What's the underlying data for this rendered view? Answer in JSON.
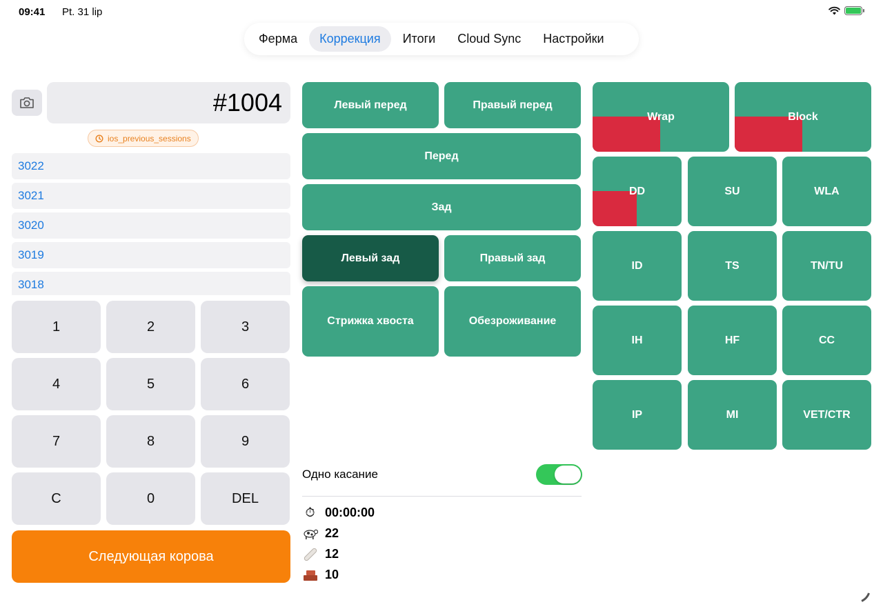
{
  "status": {
    "time": "09:41",
    "date": "Pt. 31 lip",
    "battery_color": "#34c759"
  },
  "tabs": [
    {
      "label": "Ферма",
      "active": false
    },
    {
      "label": "Коррекция",
      "active": true
    },
    {
      "label": "Итоги",
      "active": false
    },
    {
      "label": "Cloud Sync",
      "active": false
    },
    {
      "label": "Настройки",
      "active": false
    }
  ],
  "current_id": "#1004",
  "sessions_badge": "ios_previous_sessions",
  "history": [
    "3022",
    "3021",
    "3020",
    "3019",
    "3018"
  ],
  "keypad": [
    "1",
    "2",
    "3",
    "4",
    "5",
    "6",
    "7",
    "8",
    "9",
    "C",
    "0",
    "DEL"
  ],
  "next_button": "Следующая корова",
  "legs": {
    "left_front": "Левый перед",
    "right_front": "Правый перед",
    "front": "Перед",
    "back": "Зад",
    "left_back": "Левый зад",
    "right_back": "Правый зад",
    "tail_trim": "Стрижка хвоста",
    "dehorning": "Обезроживание",
    "selected": "left_back"
  },
  "treatments": {
    "wrap": "Wrap",
    "block": "Block",
    "dd": "DD",
    "su": "SU",
    "wla": "WLA",
    "id": "ID",
    "ts": "TS",
    "tntu": "TN/TU",
    "ih": "IH",
    "hf": "HF",
    "cc": "CC",
    "ip": "IP",
    "mi": "MI",
    "vetctr": "VET/CTR"
  },
  "single_touch": {
    "label": "Одно касание",
    "enabled": true
  },
  "stats": {
    "timer": "00:00:00",
    "cows": "22",
    "wraps": "12",
    "blocks": "10"
  },
  "colors": {
    "accent": "#1e7be0",
    "green": "#3da484",
    "green_selected": "#175a47",
    "red": "#d92a3f",
    "orange": "#f7810a",
    "toggle_on": "#34c759"
  }
}
